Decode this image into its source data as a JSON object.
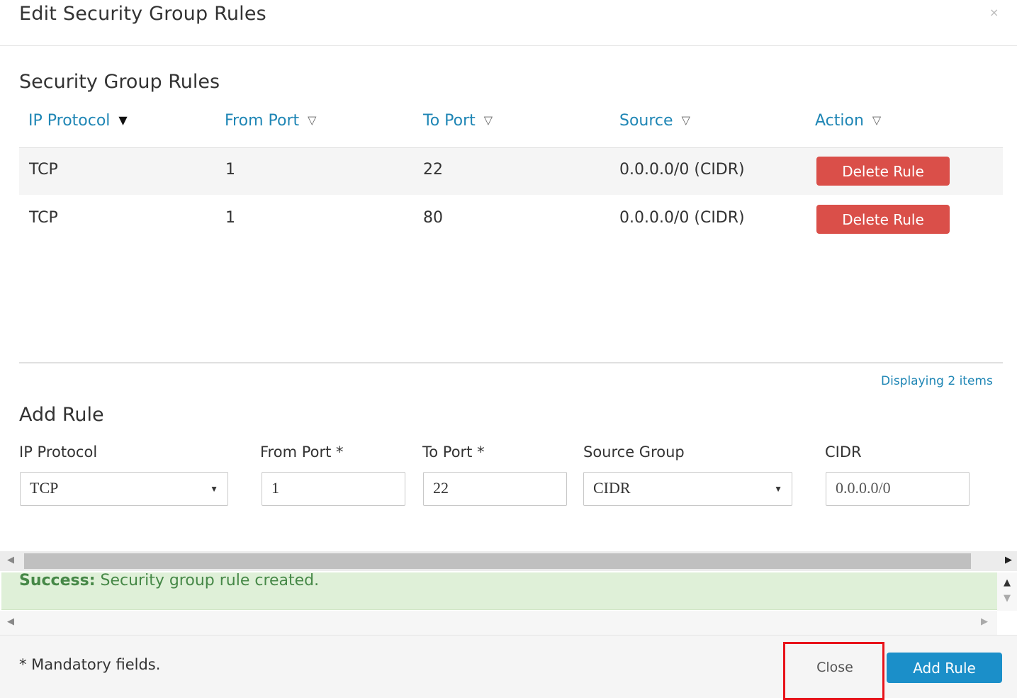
{
  "modal": {
    "title": "Edit Security Group Rules",
    "close_glyph": "×"
  },
  "rules_section": {
    "title": "Security Group Rules",
    "columns": [
      {
        "label": "IP Protocol",
        "sorted": true
      },
      {
        "label": "From Port",
        "sorted": false
      },
      {
        "label": "To Port",
        "sorted": false
      },
      {
        "label": "Source",
        "sorted": false
      },
      {
        "label": "Action",
        "sorted": false
      }
    ],
    "rows": [
      {
        "protocol": "TCP",
        "from_port": "1",
        "to_port": "22",
        "source": "0.0.0.0/0 (CIDR)",
        "action": "Delete Rule"
      },
      {
        "protocol": "TCP",
        "from_port": "1",
        "to_port": "80",
        "source": "0.0.0.0/0 (CIDR)",
        "action": "Delete Rule"
      }
    ],
    "display_count": "Displaying 2 items"
  },
  "add_rule": {
    "title": "Add Rule",
    "ip_protocol": {
      "label": "IP Protocol",
      "value": "TCP"
    },
    "from_port": {
      "label": "From Port *",
      "value": "1"
    },
    "to_port": {
      "label": "To Port *",
      "value": "22"
    },
    "source_group": {
      "label": "Source Group",
      "value": "CIDR"
    },
    "cidr": {
      "label": "CIDR",
      "value": "0.0.0.0/0"
    }
  },
  "alert": {
    "strong": "Success:",
    "message": "Security group rule created."
  },
  "footer": {
    "mandatory_note": "* Mandatory fields.",
    "close_label": "Close",
    "add_rule_label": "Add Rule"
  },
  "colors": {
    "link_blue": "#1f86b5",
    "danger_red": "#da4f49",
    "primary_blue": "#1b8fc9",
    "success_bg": "#dff0d8",
    "success_text": "#468847",
    "highlight_red": "#e8131a"
  },
  "icons": {
    "sort_active": "caret-down-solid-icon",
    "sort_inactive": "caret-down-outline-icon",
    "select_caret": "caret-down-icon",
    "scroll_left": "triangle-left-icon",
    "scroll_right": "triangle-right-icon",
    "scroll_up": "triangle-up-icon",
    "scroll_down": "triangle-down-icon"
  }
}
